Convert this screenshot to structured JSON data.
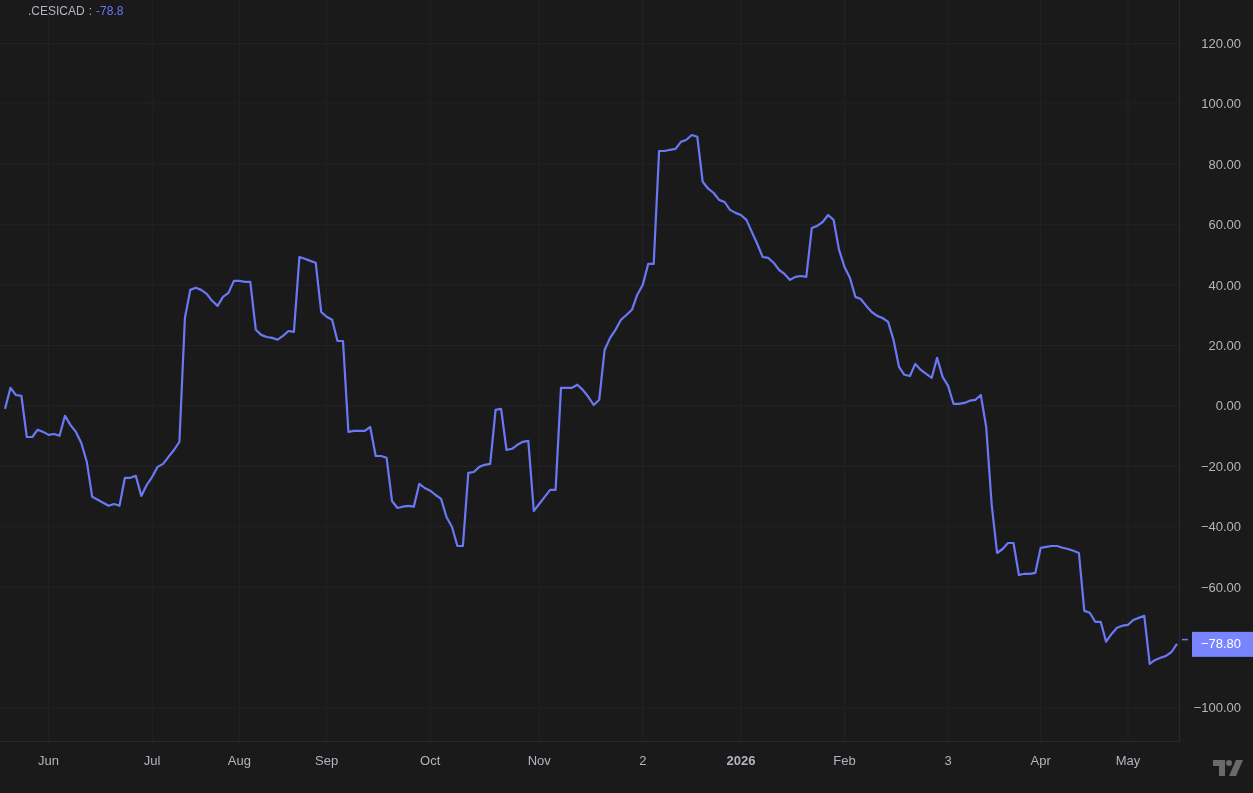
{
  "legend": {
    "separator": ":",
    "value": "-78.8"
  },
  "last_value_label": "−78.80",
  "chart_data": {
    "type": "line",
    "grid": true,
    "ylim": [
      -111.3,
      134.4
    ],
    "yticks": [
      {
        "value": 120,
        "label": "120.00"
      },
      {
        "value": 100,
        "label": "100.00"
      },
      {
        "value": 80,
        "label": "80.00"
      },
      {
        "value": 60,
        "label": "60.00"
      },
      {
        "value": 40,
        "label": "40.00"
      },
      {
        "value": 20,
        "label": "20.00"
      },
      {
        "value": 0,
        "label": "0.00"
      },
      {
        "value": -20,
        "label": "−20.00"
      },
      {
        "value": -40,
        "label": "−40.00"
      },
      {
        "value": -60,
        "label": "−60.00"
      },
      {
        "value": -100,
        "label": "−100.00"
      }
    ],
    "categories": [
      null,
      null,
      null,
      null,
      null,
      null,
      null,
      null,
      "Jun",
      null,
      null,
      null,
      null,
      null,
      null,
      null,
      null,
      null,
      null,
      null,
      null,
      null,
      null,
      null,
      null,
      null,
      null,
      "Jul",
      null,
      null,
      null,
      null,
      null,
      null,
      null,
      null,
      null,
      null,
      null,
      null,
      null,
      null,
      null,
      "Aug",
      null,
      null,
      null,
      null,
      null,
      null,
      null,
      null,
      null,
      null,
      null,
      null,
      null,
      null,
      null,
      "Sep",
      null,
      null,
      null,
      null,
      null,
      null,
      null,
      null,
      null,
      null,
      null,
      null,
      null,
      null,
      null,
      null,
      null,
      null,
      "Oct",
      null,
      null,
      null,
      null,
      null,
      null,
      null,
      null,
      null,
      null,
      null,
      null,
      null,
      null,
      null,
      null,
      null,
      null,
      null,
      "Nov",
      null,
      null,
      null,
      null,
      null,
      null,
      null,
      null,
      null,
      null,
      null,
      null,
      null,
      null,
      null,
      null,
      null,
      null,
      "2",
      null,
      null,
      null,
      null,
      null,
      null,
      null,
      null,
      null,
      null,
      null,
      null,
      null,
      null,
      null,
      null,
      null,
      "**2026**",
      null,
      null,
      null,
      null,
      null,
      null,
      null,
      null,
      null,
      null,
      null,
      null,
      null,
      null,
      null,
      null,
      null,
      null,
      "Feb",
      null,
      null,
      null,
      null,
      null,
      null,
      null,
      null,
      null,
      null,
      null,
      null,
      null,
      null,
      null,
      null,
      null,
      null,
      "3",
      null,
      null,
      null,
      null,
      null,
      null,
      null,
      null,
      null,
      null,
      null,
      null,
      null,
      null,
      null,
      null,
      "Apr",
      null,
      null,
      null,
      null,
      null,
      null,
      null,
      null,
      null,
      null,
      null,
      null,
      null,
      null,
      null,
      "May",
      null,
      null,
      null,
      null,
      null,
      null,
      null,
      null,
      null
    ],
    "series": [
      {
        "name": ".CESICAD",
        "color": "#6b78f5",
        "values": [
          -1.0,
          6.0,
          3.6,
          3.3,
          -10.3,
          -10.3,
          -7.9,
          -8.6,
          -9.6,
          -9.3,
          -9.9,
          -3.3,
          -6.3,
          -8.6,
          -12.3,
          -18.5,
          -30.1,
          -31.1,
          -32.1,
          -33.1,
          -32.5,
          -33.1,
          -23.8,
          -23.8,
          -23.2,
          -29.8,
          -26.2,
          -23.5,
          -20.2,
          -19.2,
          -16.9,
          -14.6,
          -11.9,
          29.1,
          38.4,
          39.1,
          38.4,
          37.1,
          34.8,
          33.1,
          36.1,
          37.4,
          41.4,
          41.4,
          41.1,
          41.1,
          25.2,
          23.5,
          22.8,
          22.5,
          21.9,
          23.2,
          24.8,
          24.5,
          49.3,
          48.7,
          48.0,
          47.4,
          31.1,
          29.5,
          28.5,
          21.5,
          21.5,
          -8.6,
          -8.3,
          -8.3,
          -8.3,
          -7.0,
          -16.6,
          -16.6,
          -17.2,
          -31.5,
          -33.8,
          -33.4,
          -33.1,
          -33.4,
          -25.8,
          -27.2,
          -28.1,
          -29.5,
          -30.8,
          -36.8,
          -40.1,
          -46.4,
          -46.4,
          -22.2,
          -21.9,
          -20.2,
          -19.5,
          -19.2,
          -1.3,
          -1.0,
          -14.6,
          -14.2,
          -12.9,
          -11.9,
          -11.6,
          -34.8,
          -32.5,
          -30.1,
          -27.8,
          -27.8,
          6.0,
          6.0,
          6.0,
          7.0,
          5.3,
          3.0,
          0.3,
          2.0,
          18.5,
          22.5,
          25.2,
          28.5,
          30.1,
          31.8,
          36.8,
          40.1,
          47.0,
          47.0,
          84.4,
          84.4,
          84.8,
          85.1,
          87.4,
          88.1,
          89.7,
          89.1,
          74.2,
          71.9,
          70.5,
          68.2,
          67.5,
          64.9,
          63.9,
          63.2,
          61.6,
          57.6,
          53.6,
          49.3,
          49.0,
          47.4,
          45.0,
          43.7,
          41.7,
          42.7,
          43.0,
          42.7,
          58.9,
          59.6,
          60.9,
          63.2,
          61.6,
          51.7,
          46.0,
          42.4,
          36.1,
          35.4,
          33.1,
          31.1,
          29.8,
          29.1,
          27.8,
          21.9,
          12.9,
          10.3,
          9.9,
          13.9,
          11.9,
          10.6,
          9.3,
          15.9,
          9.6,
          6.6,
          0.7,
          0.7,
          1.0,
          1.7,
          2.0,
          3.6,
          -7.0,
          -32.8,
          -48.7,
          -47.4,
          -45.4,
          -45.4,
          -56.0,
          -55.6,
          -55.6,
          -55.3,
          -47.0,
          -46.7,
          -46.4,
          -46.4,
          -47.0,
          -47.4,
          -48.0,
          -48.7,
          -67.9,
          -68.5,
          -71.5,
          -71.5,
          -78.1,
          -75.5,
          -73.5,
          -72.8,
          -72.5,
          -70.9,
          -70.2,
          -69.5,
          -85.4,
          -84.1,
          -83.4,
          -82.8,
          -81.5,
          -78.8
        ]
      }
    ]
  }
}
